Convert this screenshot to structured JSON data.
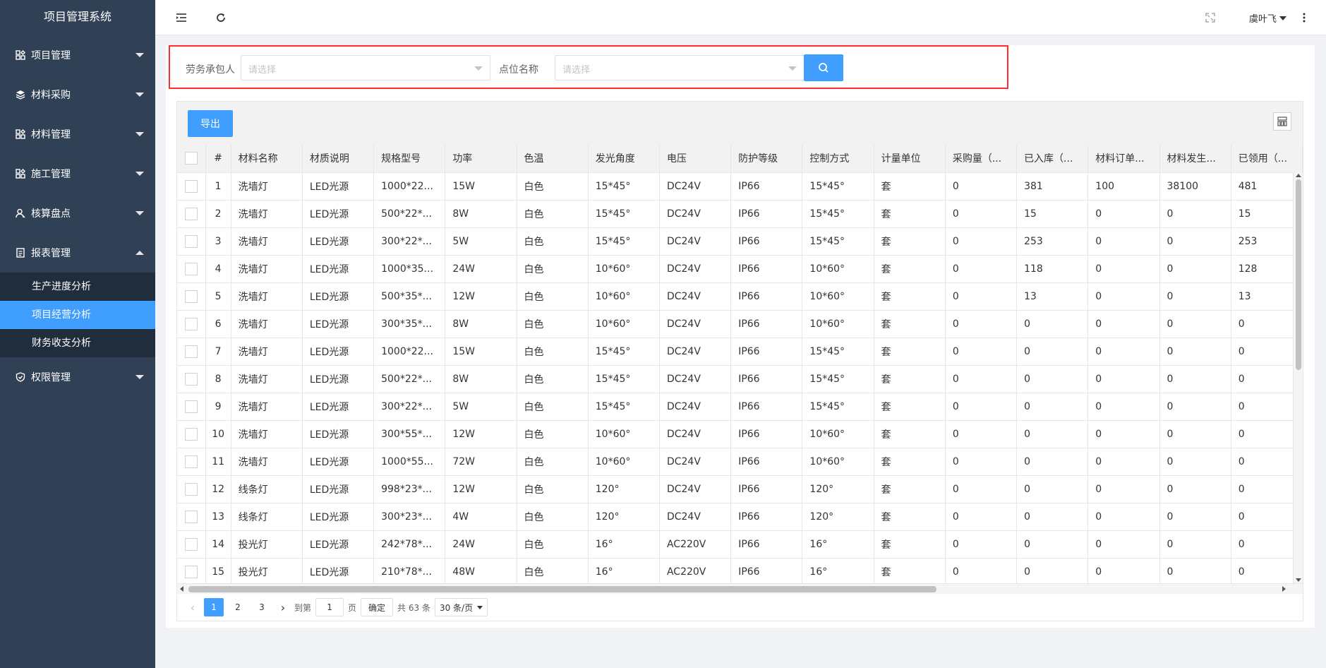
{
  "app": {
    "title": "项目管理系统"
  },
  "sidebar": {
    "menus": [
      {
        "label": "项目管理",
        "icon": "dashboard-icon",
        "expanded": false
      },
      {
        "label": "材料采购",
        "icon": "layers-icon",
        "expanded": false
      },
      {
        "label": "材料管理",
        "icon": "dashboard-icon",
        "expanded": false
      },
      {
        "label": "施工管理",
        "icon": "dashboard-icon",
        "expanded": false
      },
      {
        "label": "核算盘点",
        "icon": "user-icon",
        "expanded": false
      },
      {
        "label": "报表管理",
        "icon": "report-icon",
        "expanded": true
      },
      {
        "label": "权限管理",
        "icon": "shield-icon",
        "expanded": false
      }
    ],
    "report_sub": [
      {
        "label": "生产进度分析",
        "active": false
      },
      {
        "label": "项目经营分析",
        "active": true
      },
      {
        "label": "财务收支分析",
        "active": false
      }
    ]
  },
  "header": {
    "username": "虞叶飞"
  },
  "filters": {
    "contractor_label": "劳务承包人",
    "contractor_placeholder": "请选择",
    "point_label": "点位名称",
    "point_placeholder": "请选择"
  },
  "toolbar": {
    "export_label": "导出"
  },
  "table": {
    "columns": [
      "#",
      "材料名称",
      "材质说明",
      "规格型号",
      "功率",
      "色温",
      "发光角度",
      "电压",
      "防护等级",
      "控制方式",
      "计量单位",
      "采购量（...",
      "已入库（...",
      "材料订单...",
      "材料发生...",
      "已领用（..."
    ],
    "rows": [
      [
        "1",
        "洗墙灯",
        "LED光源",
        "1000*22...",
        "15W",
        "白色",
        "15*45°",
        "DC24V",
        "IP66",
        "15*45°",
        "套",
        "0",
        "381",
        "100",
        "38100",
        "481"
      ],
      [
        "2",
        "洗墙灯",
        "LED光源",
        "500*22*...",
        "8W",
        "白色",
        "15*45°",
        "DC24V",
        "IP66",
        "15*45°",
        "套",
        "0",
        "15",
        "0",
        "0",
        "15"
      ],
      [
        "3",
        "洗墙灯",
        "LED光源",
        "300*22*...",
        "5W",
        "白色",
        "15*45°",
        "DC24V",
        "IP66",
        "15*45°",
        "套",
        "0",
        "253",
        "0",
        "0",
        "253"
      ],
      [
        "4",
        "洗墙灯",
        "LED光源",
        "1000*35...",
        "24W",
        "白色",
        "10*60°",
        "DC24V",
        "IP66",
        "10*60°",
        "套",
        "0",
        "118",
        "0",
        "0",
        "128"
      ],
      [
        "5",
        "洗墙灯",
        "LED光源",
        "500*35*...",
        "12W",
        "白色",
        "10*60°",
        "DC24V",
        "IP66",
        "10*60°",
        "套",
        "0",
        "13",
        "0",
        "0",
        "13"
      ],
      [
        "6",
        "洗墙灯",
        "LED光源",
        "300*35*...",
        "8W",
        "白色",
        "10*60°",
        "DC24V",
        "IP66",
        "10*60°",
        "套",
        "0",
        "0",
        "0",
        "0",
        "0"
      ],
      [
        "7",
        "洗墙灯",
        "LED光源",
        "1000*22...",
        "15W",
        "白色",
        "15*45°",
        "DC24V",
        "IP66",
        "15*45°",
        "套",
        "0",
        "0",
        "0",
        "0",
        "0"
      ],
      [
        "8",
        "洗墙灯",
        "LED光源",
        "500*22*...",
        "8W",
        "白色",
        "15*45°",
        "DC24V",
        "IP66",
        "15*45°",
        "套",
        "0",
        "0",
        "0",
        "0",
        "0"
      ],
      [
        "9",
        "洗墙灯",
        "LED光源",
        "300*22*...",
        "5W",
        "白色",
        "15*45°",
        "DC24V",
        "IP66",
        "15*45°",
        "套",
        "0",
        "0",
        "0",
        "0",
        "0"
      ],
      [
        "10",
        "洗墙灯",
        "LED光源",
        "300*55*...",
        "12W",
        "白色",
        "10*60°",
        "DC24V",
        "IP66",
        "10*60°",
        "套",
        "0",
        "0",
        "0",
        "0",
        "0"
      ],
      [
        "11",
        "洗墙灯",
        "LED光源",
        "1000*55...",
        "72W",
        "白色",
        "10*60°",
        "DC24V",
        "IP66",
        "10*60°",
        "套",
        "0",
        "0",
        "0",
        "0",
        "0"
      ],
      [
        "12",
        "线条灯",
        "LED光源",
        "998*23*...",
        "12W",
        "白色",
        "120°",
        "DC24V",
        "IP66",
        "120°",
        "套",
        "0",
        "0",
        "0",
        "0",
        "0"
      ],
      [
        "13",
        "线条灯",
        "LED光源",
        "300*23*...",
        "4W",
        "白色",
        "120°",
        "DC24V",
        "IP66",
        "120°",
        "套",
        "0",
        "0",
        "0",
        "0",
        "0"
      ],
      [
        "14",
        "投光灯",
        "LED光源",
        "242*78*...",
        "24W",
        "白色",
        "16°",
        "AC220V",
        "IP66",
        "16°",
        "套",
        "0",
        "0",
        "0",
        "0",
        "0"
      ],
      [
        "15",
        "投光灯",
        "LED光源",
        "210*78*...",
        "48W",
        "白色",
        "16°",
        "AC220V",
        "IP66",
        "16°",
        "套",
        "0",
        "0",
        "0",
        "0",
        "0"
      ]
    ]
  },
  "pagination": {
    "pages": [
      "1",
      "2",
      "3"
    ],
    "current": "1",
    "goto_label": "到第",
    "goto_value": "1",
    "page_unit": "页",
    "confirm_label": "确定",
    "total_label": "共 63 条",
    "page_size": "30 条/页"
  },
  "colors": {
    "sidebar_bg": "#304156",
    "submenu_bg": "#1f2d3d",
    "accent": "#409eff",
    "highlight_border": "#ff2d2d"
  }
}
